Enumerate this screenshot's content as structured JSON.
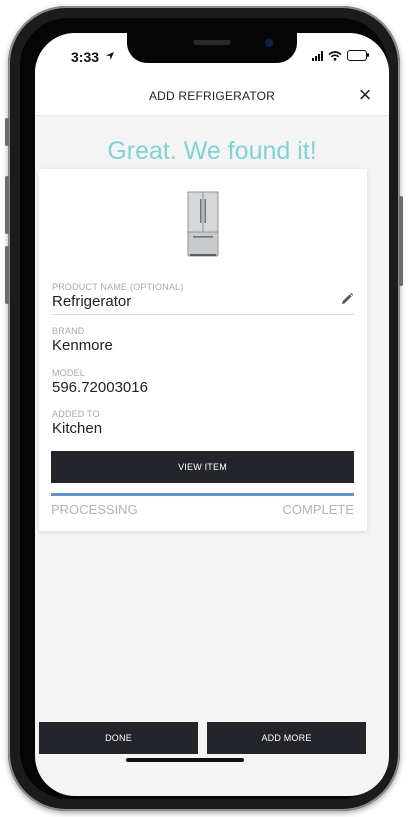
{
  "status_bar": {
    "time": "3:33"
  },
  "header": {
    "title": "ADD REFRIGERATOR",
    "close_label": "×"
  },
  "headline": "Great. We found it!",
  "product": {
    "name_label": "PRODUCT NAME (OPTIONAL)",
    "name_value": "Refrigerator",
    "brand_label": "BRAND",
    "brand_value": "Kenmore",
    "model_label": "MODEL",
    "model_value": "596.72003016",
    "location_label": "ADDED TO",
    "location_value": "Kitchen"
  },
  "view_item_label": "VIEW ITEM",
  "progress": {
    "fraction": 1.0,
    "start_label": "PROCESSING",
    "end_label": "COMPLETE"
  },
  "footer": {
    "done_label": "DONE",
    "add_more_label": "ADD MORE"
  },
  "colors": {
    "accent_teal": "#7fd3d5",
    "progress_blue": "#5b97d6",
    "button_dark": "#23252b"
  },
  "icons": [
    "close-icon",
    "edit-pencil-icon",
    "refrigerator-image",
    "location-arrow-icon",
    "signal-icon",
    "wifi-icon",
    "battery-icon"
  ]
}
